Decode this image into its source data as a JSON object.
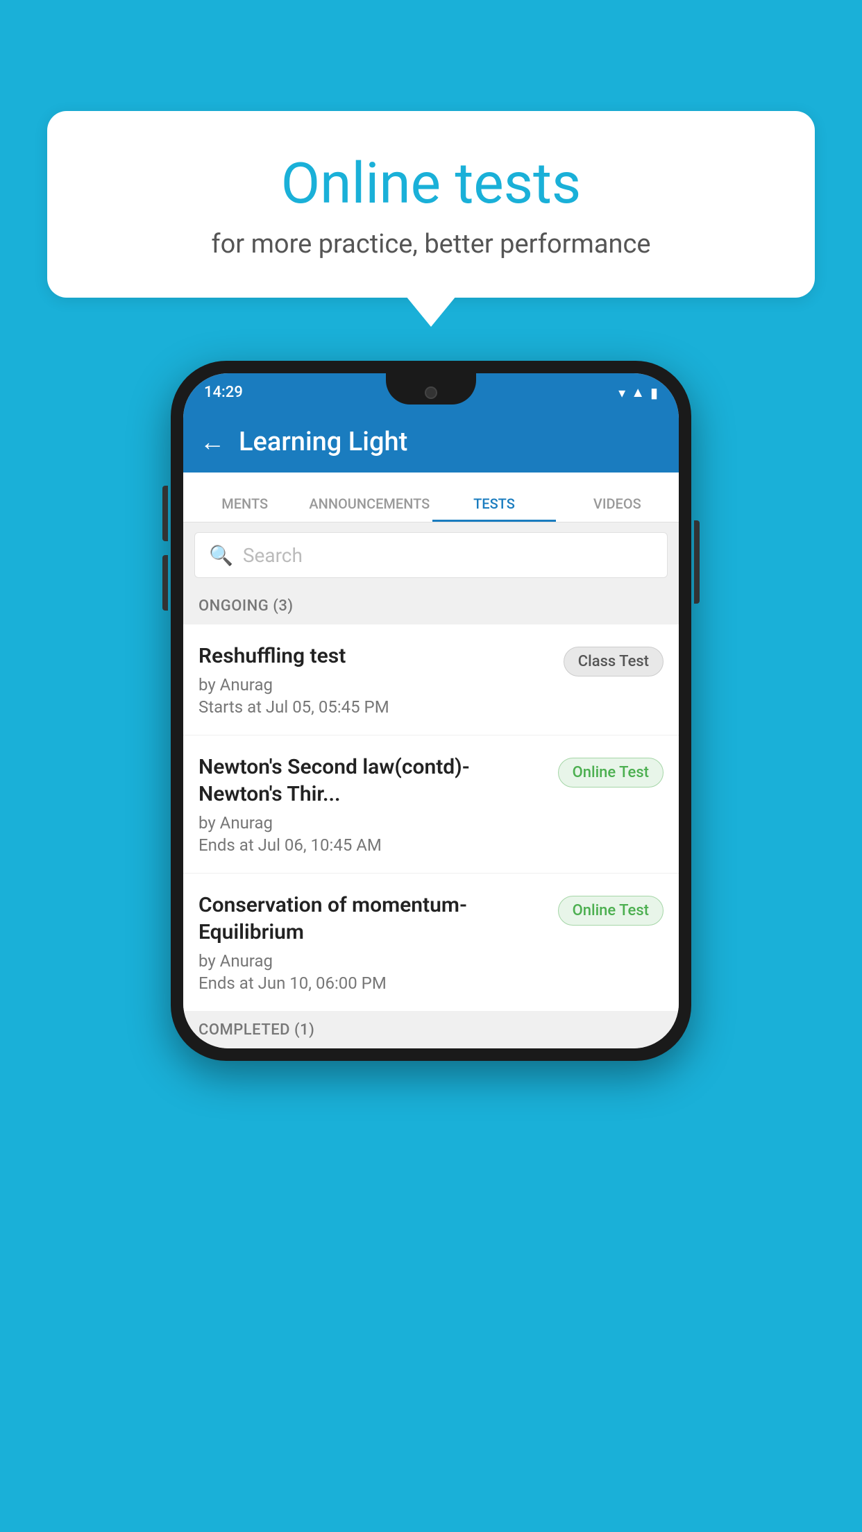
{
  "background_color": "#1ab0d8",
  "speech_bubble": {
    "title": "Online tests",
    "subtitle": "for more practice, better performance"
  },
  "phone": {
    "status_bar": {
      "time": "14:29",
      "icons": [
        "wifi",
        "signal",
        "battery"
      ]
    },
    "app_bar": {
      "title": "Learning Light",
      "back_label": "←"
    },
    "tabs": [
      {
        "label": "MENTS",
        "active": false
      },
      {
        "label": "ANNOUNCEMENTS",
        "active": false
      },
      {
        "label": "TESTS",
        "active": true
      },
      {
        "label": "VIDEOS",
        "active": false
      }
    ],
    "search": {
      "placeholder": "Search"
    },
    "sections": [
      {
        "header": "ONGOING (3)",
        "items": [
          {
            "title": "Reshuffling test",
            "by": "by Anurag",
            "date": "Starts at  Jul 05, 05:45 PM",
            "badge": "Class Test",
            "badge_type": "class"
          },
          {
            "title": "Newton's Second law(contd)-Newton's Thir...",
            "by": "by Anurag",
            "date": "Ends at  Jul 06, 10:45 AM",
            "badge": "Online Test",
            "badge_type": "online"
          },
          {
            "title": "Conservation of momentum-Equilibrium",
            "by": "by Anurag",
            "date": "Ends at  Jun 10, 06:00 PM",
            "badge": "Online Test",
            "badge_type": "online"
          }
        ]
      }
    ],
    "completed_header": "COMPLETED (1)"
  }
}
